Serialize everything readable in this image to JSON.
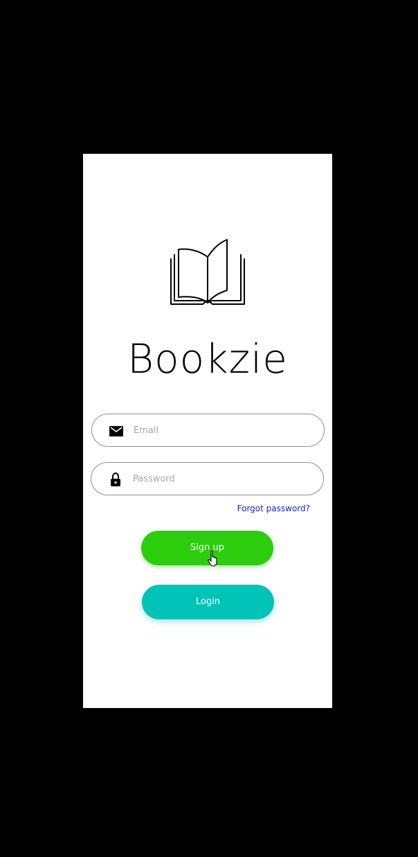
{
  "app": {
    "title": "Bookzie",
    "logo_icon": "open-book-icon"
  },
  "form": {
    "email": {
      "icon": "envelope-icon",
      "placeholder": "Email",
      "value": ""
    },
    "password": {
      "icon": "lock-icon",
      "placeholder": "Password",
      "value": ""
    },
    "forgot_label": "Forgot password?"
  },
  "buttons": {
    "signup_label": "Sign up",
    "login_label": "Login"
  },
  "colors": {
    "background": "#000000",
    "screen": "#ffffff",
    "signup": "#2ccd0d",
    "login": "#00c2b7",
    "link": "#1a23c9",
    "field_border": "#8e8e8e"
  }
}
